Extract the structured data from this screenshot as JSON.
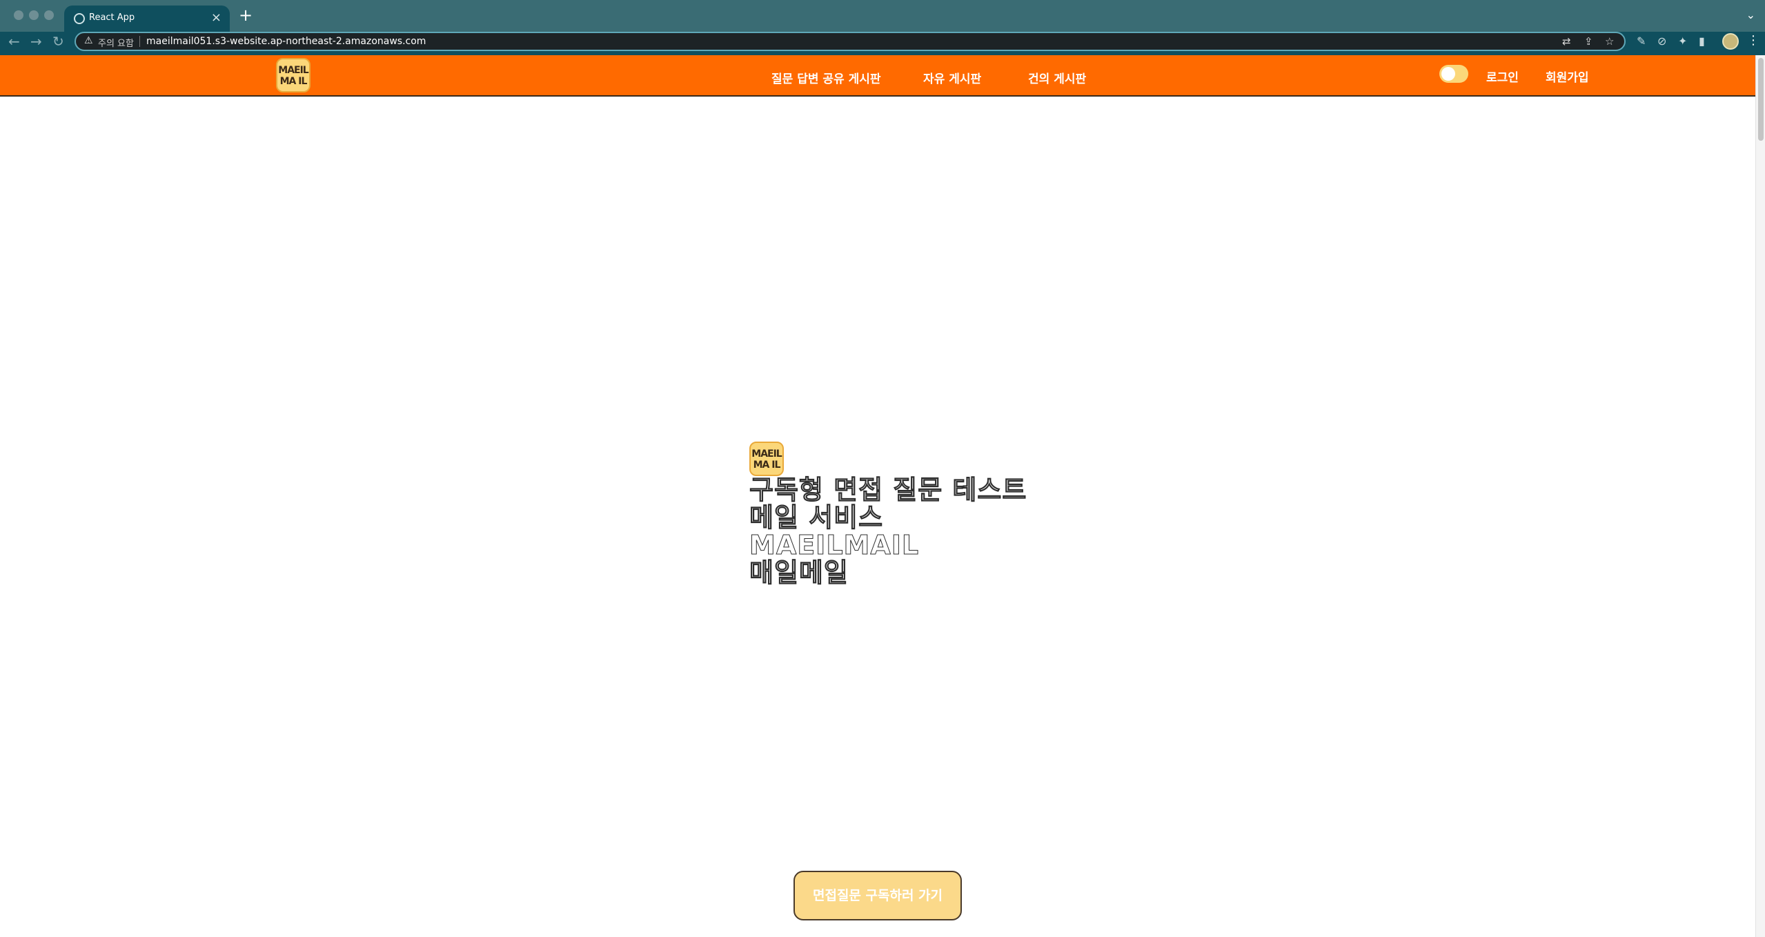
{
  "browser": {
    "tab_title": "React App",
    "new_tab_symbol": "+",
    "close_symbol": "×",
    "security_text": "주의 요함",
    "url": "maeilmail051.s3-website.ap-northeast-2.amazonaws.com"
  },
  "header": {
    "logo_line1": "MAEIL",
    "logo_line2": "MA IL",
    "nav": [
      {
        "label": "질문 답변 공유 게시판"
      },
      {
        "label": "자유 게시판"
      },
      {
        "label": "건의 게시판"
      }
    ],
    "login_label": "로그인",
    "signup_label": "회원가입"
  },
  "hero": {
    "logo_line1": "MAEIL",
    "logo_line2": "MA IL",
    "lines": [
      "구독형 면접 질문 테스트",
      "메일 서비스",
      "MAEILMAIL",
      "매일메일"
    ]
  },
  "cta": {
    "label": "면접질문 구독하러 가기"
  },
  "colors": {
    "header_bg": "#ff6a00",
    "accent_yellow": "#fbd77a",
    "browser_tabbar": "#3a6c74",
    "browser_toolbar": "#0f4f5e"
  }
}
